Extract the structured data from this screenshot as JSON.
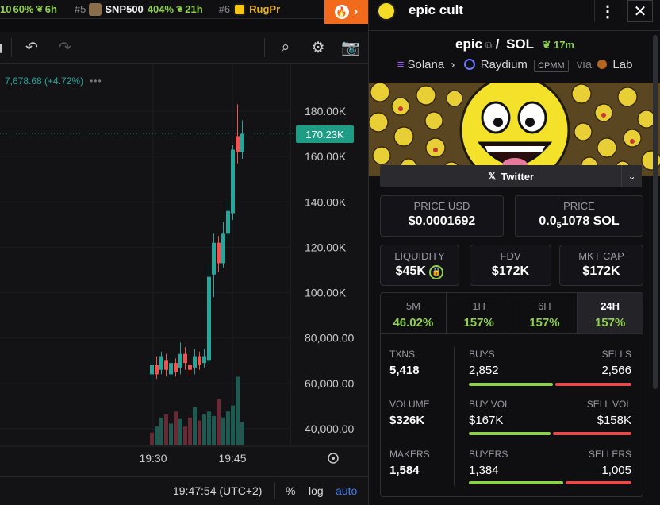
{
  "ticker": [
    {
      "rank": "",
      "sym": "",
      "pct": "60%",
      "time": "6h",
      "partial_prefix": "10"
    },
    {
      "rank": "#5",
      "sym": "SNP500",
      "pct": "404%",
      "time": "21h"
    },
    {
      "rank": "#6",
      "sym": "RugPr",
      "pct": "",
      "time": ""
    }
  ],
  "chart": {
    "legend_value": "7,678.68 (+4.72%)",
    "current_price_label": "170.23K",
    "y_ticks": [
      "180.00K",
      "160.00K",
      "140.00K",
      "120.00K",
      "100.00K",
      "80,000.00",
      "60,000.00",
      "40,000.00"
    ],
    "x_ticks": [
      "19:30",
      "19:45"
    ],
    "candles": [
      {
        "o": 64,
        "c": 68,
        "h": 71,
        "l": 61
      },
      {
        "o": 68,
        "c": 64,
        "h": 72,
        "l": 62
      },
      {
        "o": 66,
        "c": 72,
        "h": 74,
        "l": 64
      },
      {
        "o": 70,
        "c": 66,
        "h": 73,
        "l": 63
      },
      {
        "o": 64,
        "c": 69,
        "h": 72,
        "l": 62
      },
      {
        "o": 69,
        "c": 65,
        "h": 71,
        "l": 63
      },
      {
        "o": 67,
        "c": 73,
        "h": 78,
        "l": 64
      },
      {
        "o": 73,
        "c": 69,
        "h": 76,
        "l": 66
      },
      {
        "o": 68,
        "c": 66,
        "h": 70,
        "l": 63
      },
      {
        "o": 67,
        "c": 72,
        "h": 75,
        "l": 64
      },
      {
        "o": 72,
        "c": 68,
        "h": 74,
        "l": 66
      },
      {
        "o": 69,
        "c": 72,
        "h": 75,
        "l": 67
      },
      {
        "o": 70,
        "c": 107,
        "h": 112,
        "l": 68
      },
      {
        "o": 108,
        "c": 122,
        "h": 126,
        "l": 98
      },
      {
        "o": 122,
        "c": 113,
        "h": 125,
        "l": 109
      },
      {
        "o": 113,
        "c": 126,
        "h": 131,
        "l": 111
      },
      {
        "o": 126,
        "c": 136,
        "h": 140,
        "l": 123
      },
      {
        "o": 135,
        "c": 163,
        "h": 165,
        "l": 132
      },
      {
        "o": 169,
        "c": 162,
        "h": 183,
        "l": 157
      },
      {
        "o": 162,
        "c": 170,
        "h": 176,
        "l": 159
      }
    ],
    "volumes": [
      8,
      12,
      18,
      20,
      14,
      22,
      17,
      12,
      18,
      25,
      16,
      20,
      22,
      19,
      30,
      18,
      22,
      26,
      45,
      15
    ],
    "volume_up": [
      false,
      true,
      true,
      false,
      true,
      false,
      true,
      false,
      false,
      true,
      false,
      true,
      true,
      true,
      false,
      true,
      true,
      true,
      true,
      true
    ]
  },
  "status": {
    "time": "19:47:54 (UTC+2)",
    "pct": "%",
    "log": "log",
    "auto": "auto"
  },
  "panel": {
    "title": "epic cult",
    "pair_base": "epic",
    "pair_sep": "/",
    "pair_quote": "SOL",
    "age": "17m",
    "chain": "Solana",
    "dex": "Raydium",
    "dex_tag": "CPMM",
    "via": "via",
    "launchpad": "Lab",
    "twitter_label": "Twitter",
    "price_usd_label": "PRICE USD",
    "price_usd": "$0.0001692",
    "price_label": "PRICE",
    "price_sol_a": "0.0",
    "price_sol_sub": "5",
    "price_sol_b": "1078 SOL",
    "liquidity_label": "LIQUIDITY",
    "liquidity": "$45K",
    "fdv_label": "FDV",
    "fdv": "$172K",
    "mcap_label": "MKT CAP",
    "mcap": "$172K",
    "tabs": [
      {
        "label": "5M",
        "value": "46.02%"
      },
      {
        "label": "1H",
        "value": "157%"
      },
      {
        "label": "6H",
        "value": "157%"
      },
      {
        "label": "24H",
        "value": "157%"
      }
    ],
    "txns_label": "TXNS",
    "txns": "5,418",
    "buys_label": "BUYS",
    "buys": "2,852",
    "sells_label": "SELLS",
    "sells": "2,566",
    "volume_label": "VOLUME",
    "volume": "$326K",
    "buyvol_label": "BUY VOL",
    "buyvol": "$167K",
    "sellvol_label": "SELL VOL",
    "sellvol": "$158K",
    "makers_label": "MAKERS",
    "makers": "1,584",
    "buyers_label": "BUYERS",
    "buyers": "1,384",
    "sellers_label": "SELLERS",
    "sellers": "1,005"
  }
}
